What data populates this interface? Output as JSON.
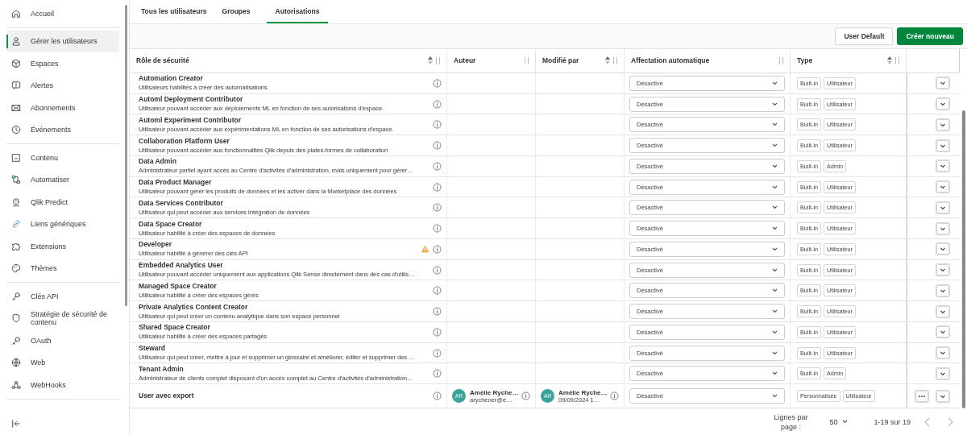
{
  "sidebar": {
    "groups": [
      [
        {
          "label": "Accueil",
          "kind": "home",
          "selected": false
        }
      ],
      [
        {
          "label": "Gérer les utilisateurs",
          "kind": "user",
          "selected": true
        },
        {
          "label": "Espaces",
          "kind": "cube",
          "selected": false
        },
        {
          "label": "Alertes",
          "kind": "alert",
          "selected": false
        },
        {
          "label": "Abonnements",
          "kind": "mail",
          "selected": false
        },
        {
          "label": "Événements",
          "kind": "clock",
          "selected": false
        }
      ],
      [
        {
          "label": "Contenu",
          "kind": "content",
          "selected": false
        },
        {
          "label": "Automatiser",
          "kind": "flow",
          "selected": false
        },
        {
          "label": "Qlik Predict",
          "kind": "predict",
          "selected": false
        },
        {
          "label": "Liens génériques",
          "kind": "link",
          "selected": false
        },
        {
          "label": "Extensions",
          "kind": "puzzle",
          "selected": false
        },
        {
          "label": "Thèmes",
          "kind": "palette",
          "selected": false
        }
      ],
      [
        {
          "label": "Clés API",
          "kind": "key",
          "selected": false
        },
        {
          "label": "Stratégie de sécurité de contenu",
          "kind": "shield",
          "selected": false
        },
        {
          "label": "OAuth",
          "kind": "key",
          "selected": false
        },
        {
          "label": "Web",
          "kind": "globe",
          "selected": false
        },
        {
          "label": "WebHooks",
          "kind": "hooks",
          "selected": false
        }
      ]
    ]
  },
  "tabs": [
    {
      "label": "Tous les utilisateurs",
      "selected": false
    },
    {
      "label": "Groupes",
      "selected": false
    },
    {
      "label": "Autorisations",
      "selected": true
    }
  ],
  "toolbar": {
    "buttons": [
      {
        "label": "User Default",
        "kind": "secondary"
      },
      {
        "label": "Créer nouveau",
        "kind": "primary"
      }
    ]
  },
  "table": {
    "columns": [
      {
        "label": "Rôle de sécurité",
        "sortable": true
      },
      {
        "label": "Auteur",
        "sortable": false
      },
      {
        "label": "Modifié par",
        "sortable": true
      },
      {
        "label": "Affectation automatique",
        "sortable": false
      },
      {
        "label": "Type",
        "sortable": true
      }
    ],
    "rows": [
      {
        "name": "Automation Creator",
        "description": "Utilisateurs habilités à créer des automatisations",
        "warning": false,
        "assignment": "Désactivé",
        "tags": [
          "Built-in",
          "Utilisateur"
        ]
      },
      {
        "name": "Automl Deployment Contributor",
        "description": "Utilisateur pouvant accéder aux déploiements ML en fonction de ses autorisations d'espace.",
        "warning": false,
        "assignment": "Désactivé",
        "tags": [
          "Built-in",
          "Utilisateur"
        ]
      },
      {
        "name": "Automl Experiment Contributor",
        "description": "Utilisateur pouvant accéder aux expérimentations ML en fonction de ses autorisations d'espace.",
        "warning": false,
        "assignment": "Désactivé",
        "tags": [
          "Built-in",
          "Utilisateur"
        ]
      },
      {
        "name": "Collaboration Platform User",
        "description": "Utilisateur pouvant accéder aux fonctionnalités Qlik depuis des plates-formes de collaboration",
        "warning": false,
        "assignment": "Désactivé",
        "tags": [
          "Built-in",
          "Utilisateur"
        ]
      },
      {
        "name": "Data Admin",
        "description": "Administrateur partiel ayant accès au Centre d'activités d'administration, mais uniquement pour gérer…",
        "warning": false,
        "assignment": "Désactivé",
        "tags": [
          "Built-in",
          "Admin"
        ]
      },
      {
        "name": "Data Product Manager",
        "description": "Utilisateur pouvant gérer les produits de données et les activer dans la Marketplace des données",
        "warning": false,
        "assignment": "Désactivé",
        "tags": [
          "Built-in",
          "Utilisateur"
        ]
      },
      {
        "name": "Data Services Contributor",
        "description": "Utilisateur qui peut accéder aux services Intégration de données",
        "warning": false,
        "assignment": "Désactivé",
        "tags": [
          "Built-in",
          "Utilisateur"
        ]
      },
      {
        "name": "Data Space Creator",
        "description": "Utilisateur habilité à créer des espaces de données",
        "warning": false,
        "assignment": "Désactivé",
        "tags": [
          "Built-in",
          "Utilisateur"
        ]
      },
      {
        "name": "Developer",
        "description": "Utilisateur habilité à générer des clés API",
        "warning": true,
        "assignment": "Désactivé",
        "tags": [
          "Built-in",
          "Utilisateur"
        ]
      },
      {
        "name": "Embedded Analytics User",
        "description": "Utilisateur pouvant accéder uniquement aux applications Qlik Sense directement dans des cas d'utilis…",
        "warning": false,
        "assignment": "Désactivé",
        "tags": [
          "Built-in",
          "Utilisateur"
        ]
      },
      {
        "name": "Managed Space Creator",
        "description": "Utilisateur habilité à créer des espaces gérés",
        "warning": false,
        "assignment": "Désactivé",
        "tags": [
          "Built-in",
          "Utilisateur"
        ]
      },
      {
        "name": "Private Analytics Content Creator",
        "description": "Utilisateur qui peut créer un contenu analytique dans son espace personnel",
        "warning": false,
        "assignment": "Désactivé",
        "tags": [
          "Built-in",
          "Utilisateur"
        ]
      },
      {
        "name": "Shared Space Creator",
        "description": "Utilisateur habilité à créer des espaces partagés",
        "warning": false,
        "assignment": "Désactivé",
        "tags": [
          "Built-in",
          "Utilisateur"
        ]
      },
      {
        "name": "Steward",
        "description": "Utilisateur qui peut créer, mettre à jour et supprimer un glossaire et améliorer, éditer et supprimer des …",
        "warning": false,
        "assignment": "Désactivé",
        "tags": [
          "Built-in",
          "Utilisateur"
        ]
      },
      {
        "name": "Tenant Admin",
        "description": "Administrateur de clients complet disposant d'un accès complet au Centre d'activités d'administration…",
        "warning": false,
        "assignment": "Désactivé",
        "tags": [
          "Built-in",
          "Admin"
        ]
      },
      {
        "name": "User avec export",
        "warning": false,
        "author": {
          "initials": "AR",
          "name": "Amélie Ryche…",
          "detail": "arychener@e…"
        },
        "modified": {
          "initials": "AR",
          "name": "Amélie Ryche…",
          "detail": "09/09/2024 1…"
        },
        "assignment": "Désactivé",
        "tags": [
          "Personnalisée",
          "Utilisateur"
        ],
        "more": true
      }
    ]
  },
  "pagination": {
    "rows_label": "Lignes par page :",
    "rows_per_page": "50",
    "range": "1-19 sur 19"
  }
}
